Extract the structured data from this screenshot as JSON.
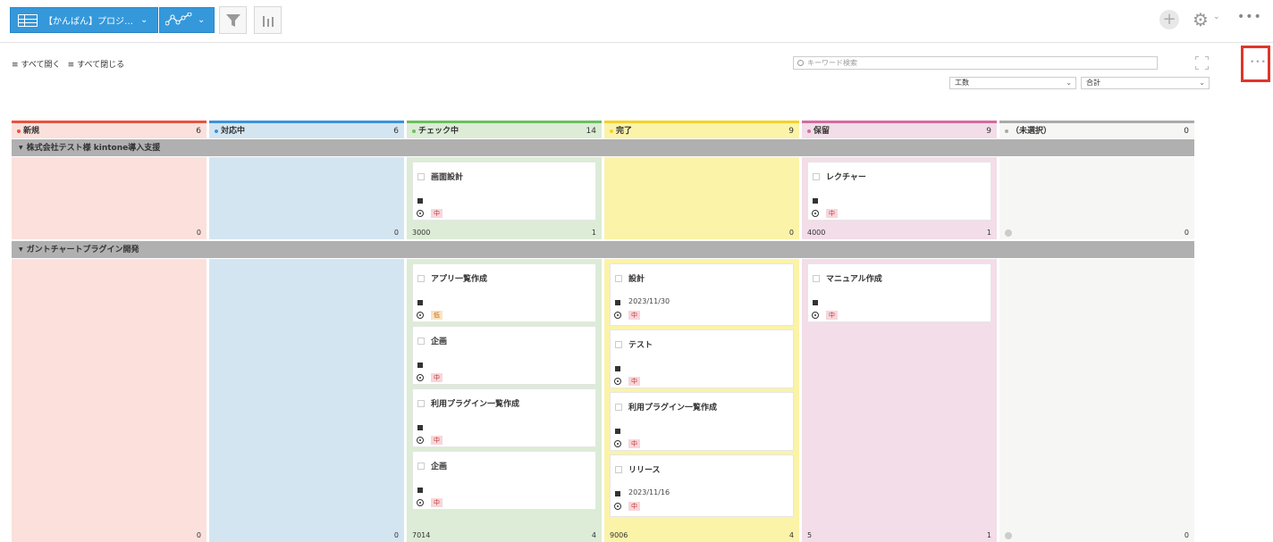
{
  "toolbar": {
    "view_label": "【かんばん】プロジ…",
    "icons": [
      "table-icon",
      "graph-icon",
      "filter-icon",
      "bar-chart-icon",
      "plus-icon",
      "gear-icon",
      "more-icon"
    ]
  },
  "subbar": {
    "expand_all": "すべて開く",
    "collapse_all": "すべて閉じる",
    "search_placeholder": "キーワード検索",
    "field_select": "工数",
    "agg_select": "合計"
  },
  "columns": [
    {
      "label": "新規",
      "count": "6",
      "color": "#e8533f"
    },
    {
      "label": "対応中",
      "count": "6",
      "color": "#3b93db"
    },
    {
      "label": "チェック中",
      "count": "14",
      "color": "#6cbf5e"
    },
    {
      "label": "完了",
      "count": "9",
      "color": "#f2d22a"
    },
    {
      "label": "保留",
      "count": "9",
      "color": "#d56ba0"
    },
    {
      "label": "（未選択）",
      "count": "0",
      "color": "#aaaaaa"
    }
  ],
  "lanes": [
    {
      "title": "株式会社テスト様 kintone導入支援",
      "cells": [
        {
          "total": "",
          "count": "0",
          "cards": []
        },
        {
          "total": "",
          "count": "0",
          "cards": []
        },
        {
          "total": "3000",
          "count": "1",
          "cards": [
            {
              "title": "画面設計",
              "date": "",
              "priority": "中"
            }
          ]
        },
        {
          "total": "",
          "count": "0",
          "cards": []
        },
        {
          "total": "4000",
          "count": "1",
          "cards": [
            {
              "title": "レクチャー",
              "date": "",
              "priority": "中"
            }
          ]
        },
        {
          "total": "",
          "count": "0",
          "cards": []
        }
      ]
    },
    {
      "title": "ガントチャートプラグイン開発",
      "cells": [
        {
          "total": "",
          "count": "0",
          "cards": []
        },
        {
          "total": "",
          "count": "0",
          "cards": []
        },
        {
          "total": "7014",
          "count": "4",
          "cards": [
            {
              "title": "アプリ一覧作成",
              "date": "",
              "priority": "低"
            },
            {
              "title": "企画",
              "date": "",
              "priority": "中"
            },
            {
              "title": "利用プラグイン一覧作成",
              "date": "",
              "priority": "中"
            },
            {
              "title": "企画",
              "date": "",
              "priority": "中"
            }
          ]
        },
        {
          "total": "9006",
          "count": "4",
          "cards": [
            {
              "title": "設計",
              "date": "2023/11/30",
              "priority": "中"
            },
            {
              "title": "テスト",
              "date": "",
              "priority": "中"
            },
            {
              "title": "利用プラグイン一覧作成",
              "date": "",
              "priority": "中"
            },
            {
              "title": "リリース",
              "date": "2023/11/16",
              "priority": "中"
            }
          ]
        },
        {
          "total": "5",
          "count": "1",
          "cards": [
            {
              "title": "マニュアル作成",
              "date": "",
              "priority": "中"
            }
          ]
        },
        {
          "total": "",
          "count": "0",
          "cards": []
        }
      ]
    }
  ]
}
